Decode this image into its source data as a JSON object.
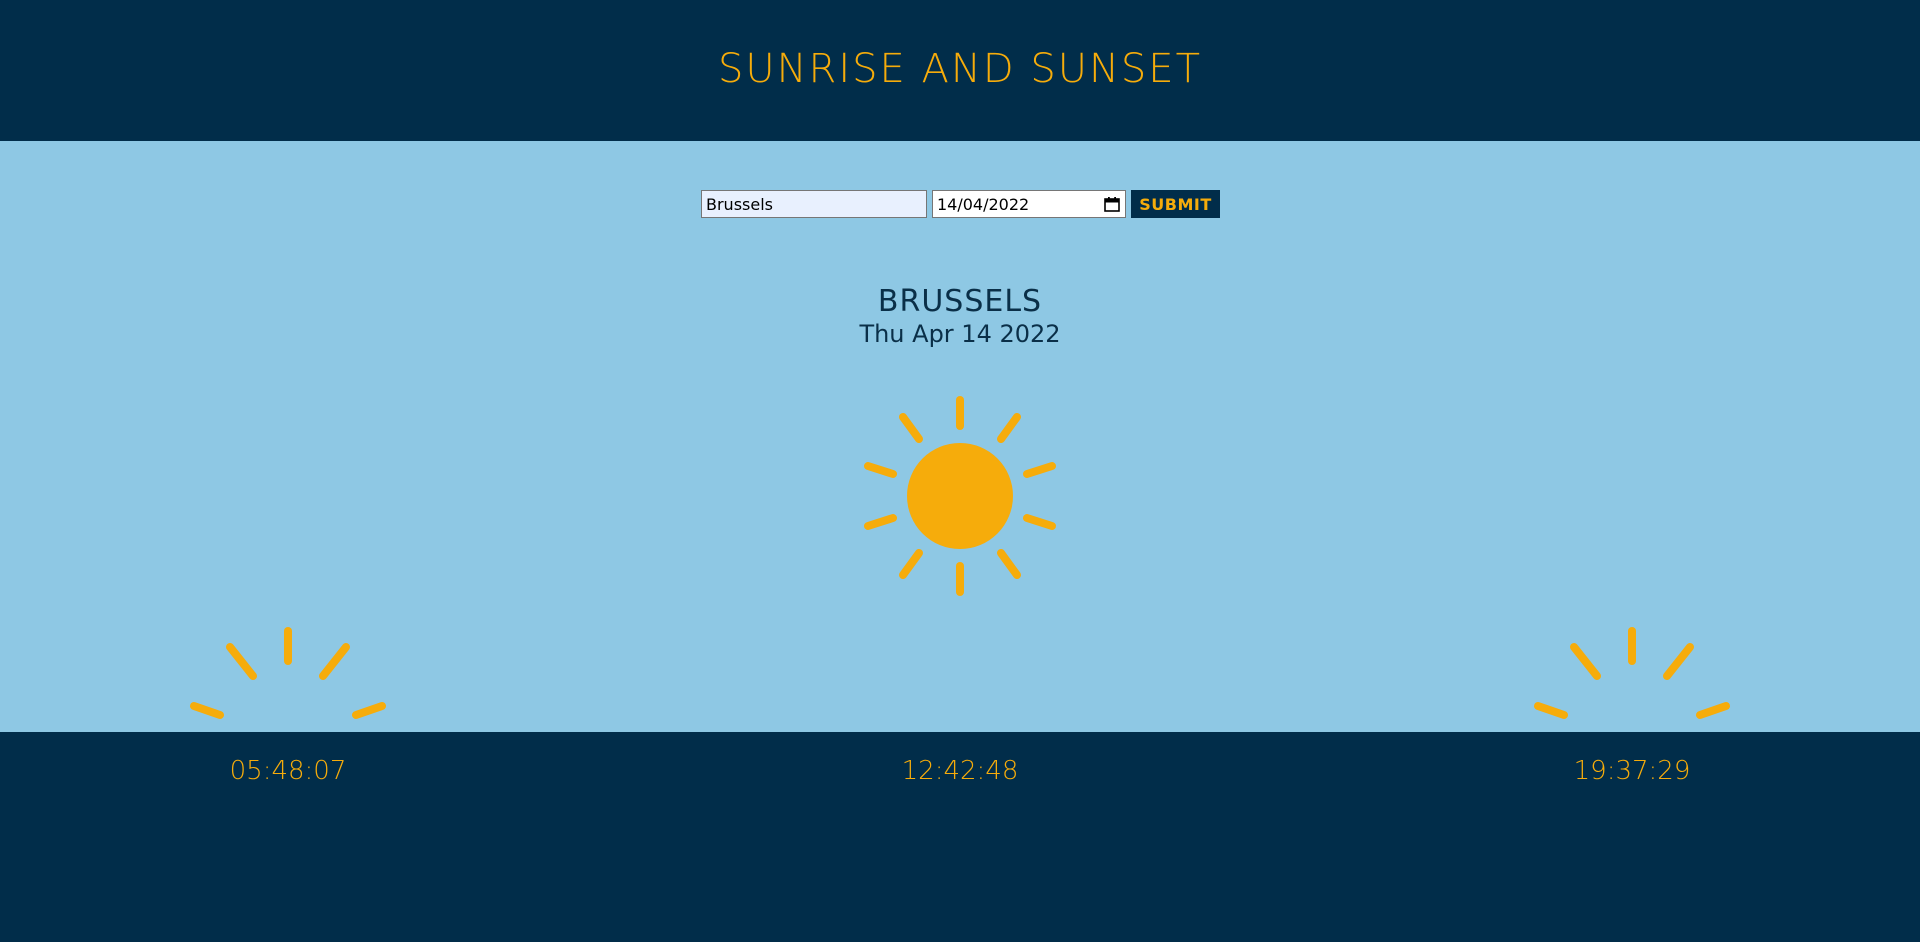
{
  "header": {
    "title": "SUNRISE AND SUNSET"
  },
  "form": {
    "city_value": "Brussels",
    "date_value": "14/04/2022",
    "submit_label": "SUBMIT"
  },
  "location": {
    "city": "BRUSSELS",
    "date": "Thu Apr 14 2022"
  },
  "times": {
    "sunrise": "05:48:07",
    "solar_noon": "12:42:48",
    "sunset": "19:37:29"
  },
  "colors": {
    "header_bg": "#012d4a",
    "sky_bg": "#8ec8e4",
    "sun": "#f6ac0b",
    "accent_text": "#f6ac0b",
    "dark_text": "#0a2f48"
  },
  "icons": {
    "noon": "sun-icon",
    "sunrise": "sunrise-icon",
    "sunset": "sunset-icon",
    "date_picker": "calendar-icon"
  }
}
